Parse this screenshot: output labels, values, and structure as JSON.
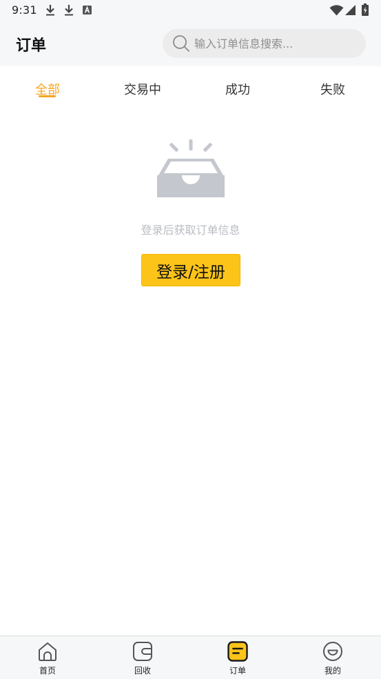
{
  "status_bar": {
    "time": "9:31",
    "icons": [
      "download-icon",
      "download-icon",
      "keyboard-icon",
      "wifi-icon",
      "signal-icon",
      "battery-charging-icon"
    ]
  },
  "header": {
    "title": "订单",
    "search": {
      "placeholder": "输入订单信息搜索...",
      "value": ""
    }
  },
  "tabs": [
    {
      "label": "全部",
      "active": true
    },
    {
      "label": "交易中",
      "active": false
    },
    {
      "label": "成功",
      "active": false
    },
    {
      "label": "失败",
      "active": false
    }
  ],
  "empty_state": {
    "icon": "empty-inbox-icon",
    "message": "登录后获取订单信息",
    "button_label": "登录/注册"
  },
  "bottom_nav": [
    {
      "label": "首页",
      "icon": "home-icon",
      "active": false
    },
    {
      "label": "回收",
      "icon": "wallet-icon",
      "active": false
    },
    {
      "label": "订单",
      "icon": "order-icon",
      "active": true
    },
    {
      "label": "我的",
      "icon": "profile-icon",
      "active": false
    }
  ],
  "colors": {
    "accent": "#f5a623",
    "button_bg": "#fcc419",
    "muted_text": "#b9bcc2",
    "header_bg": "#f6f7f9"
  }
}
